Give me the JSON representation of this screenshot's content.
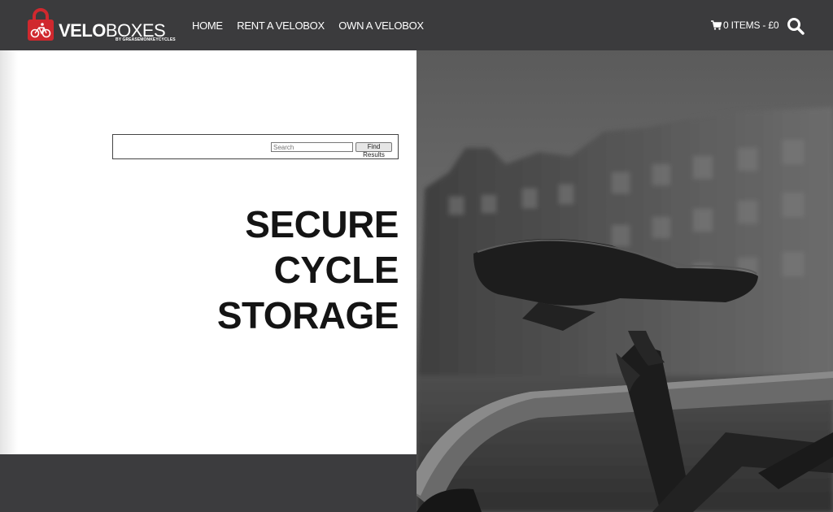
{
  "header": {
    "logo": {
      "brand_bold": "VELO",
      "brand_light": "BOXES",
      "byline": "BY GREASEMONKEYCYCLES"
    },
    "nav": [
      {
        "label": "HOME"
      },
      {
        "label": "RENT A VELOBOX"
      },
      {
        "label": "OWN A VELOBOX"
      }
    ],
    "cart": {
      "label": "0 ITEMS - £0",
      "icon": "cart-icon"
    },
    "search_icon": "search-icon"
  },
  "search": {
    "placeholder": "Search",
    "button_label": "Find Results"
  },
  "hero": {
    "headline": [
      "SECURE",
      "CYCLE",
      "STORAGE"
    ],
    "image": "bicycle-saddle-photo"
  },
  "colors": {
    "header_bg": "#3b3b3d",
    "brand_red": "#d0282e",
    "panel_bg": "#ffffff",
    "headline": "#141414"
  }
}
